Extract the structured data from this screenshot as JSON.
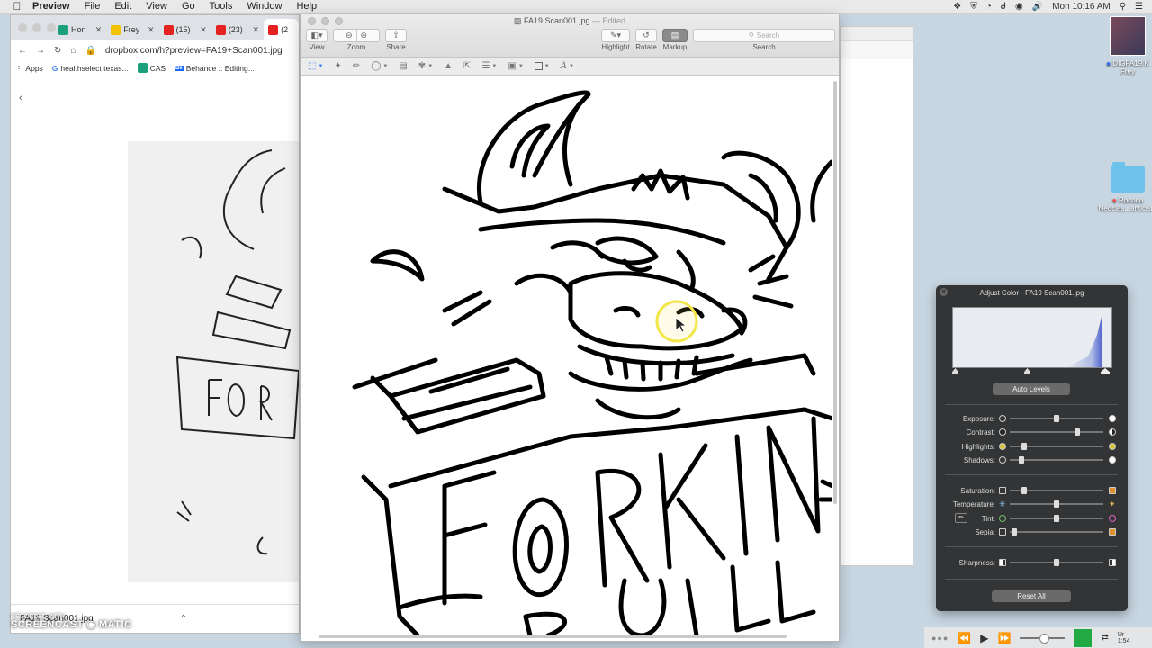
{
  "menubar": {
    "app": "Preview",
    "items": [
      "File",
      "Edit",
      "View",
      "Go",
      "Tools",
      "Window",
      "Help"
    ],
    "clock": "Mon 10:16 AM"
  },
  "desktop": {
    "items": [
      {
        "label_line1": "DIGFA19 K",
        "label_line2": "Frey"
      },
      {
        "label_line1": "Rococo",
        "label_line2": "Neoclas...anticism"
      }
    ]
  },
  "chrome": {
    "tabs": [
      {
        "label": "Hon",
        "icon": "green"
      },
      {
        "label": "Frey",
        "icon": "yellow"
      },
      {
        "label": "(15)",
        "icon": "red"
      },
      {
        "label": "(23)",
        "icon": "red"
      },
      {
        "label": "(2",
        "icon": "red"
      }
    ],
    "url": "dropbox.com/h?preview=FA19+Scan001.jpg",
    "bookmarks": [
      "Apps",
      "healthselect texas...",
      "CAS",
      "Behance :: Editing..."
    ],
    "download_name": "FA19 Scan001.jpg"
  },
  "screencast": {
    "line1": "RECORDED WITH",
    "line2": "SCREENCAST",
    "line3": "MATIC"
  },
  "preview": {
    "title": "FA19 Scan001.jpg",
    "edited": "— Edited",
    "toolbar": {
      "view": "View",
      "zoom": "Zoom",
      "share": "Share",
      "highlight": "Highlight",
      "rotate": "Rotate",
      "markup": "Markup",
      "search_label": "Search",
      "search_placeholder": "Search"
    },
    "artwork_text": [
      "FORKIN",
      "BULL"
    ]
  },
  "adjust": {
    "title": "Adjust Color - FA19 Scan001.jpg",
    "auto_levels": "Auto Levels",
    "reset_all": "Reset All",
    "sliders": [
      {
        "label": "Exposure:",
        "value": 0.5
      },
      {
        "label": "Contrast:",
        "value": 0.73
      },
      {
        "label": "Highlights:",
        "value": 0.13
      },
      {
        "label": "Shadows:",
        "value": 0.1
      },
      {
        "label": "Saturation:",
        "value": 0.13
      },
      {
        "label": "Temperature:",
        "value": 0.5
      },
      {
        "label": "Tint:",
        "value": 0.5
      },
      {
        "label": "Sepia:",
        "value": 0.02
      },
      {
        "label": "Sharpness:",
        "value": 0.5
      }
    ]
  },
  "mediabar": {
    "ext_line1": "Ur",
    "ext_line2": "1:54"
  },
  "colors": {
    "accent": "#3478f6",
    "dropbox_blue": "#0061fe",
    "youtube_red": "#e42222",
    "highlight_ring": "#f3e64a"
  }
}
